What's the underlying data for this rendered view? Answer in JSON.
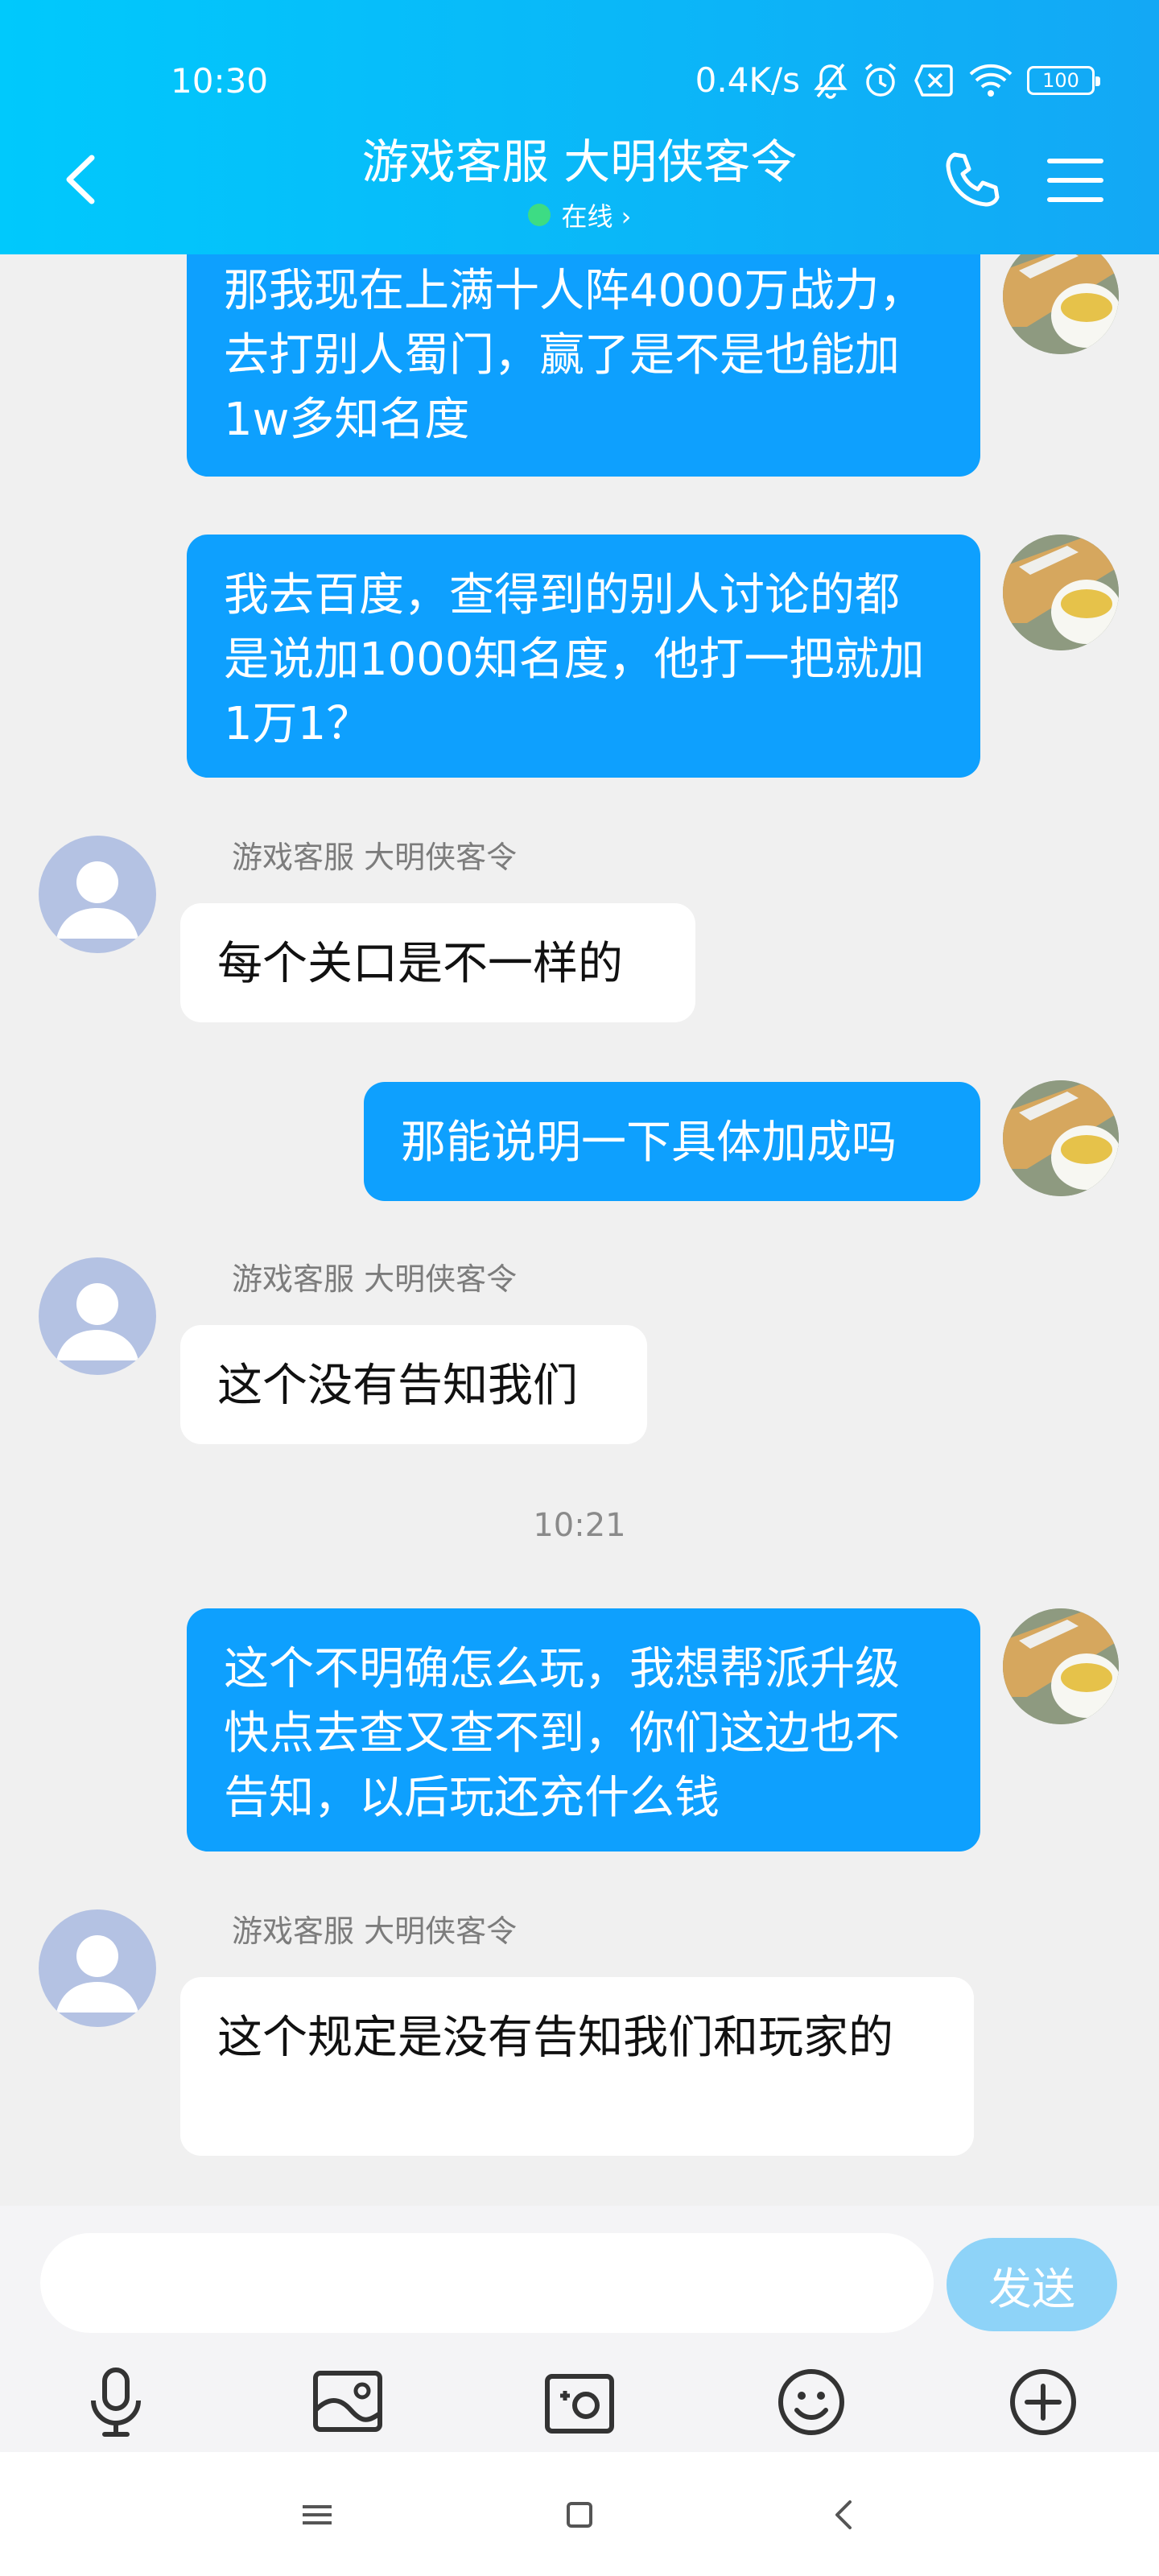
{
  "status_bar": {
    "time": "10:30",
    "net_speed": "0.4K/s",
    "battery": "100"
  },
  "header": {
    "title": "游戏客服 大明侠客令",
    "status": "在线 ›"
  },
  "messages": {
    "m1": "那我现在上满十人阵4000万战力，去打别人蜀门，赢了是不是也能加1w多知名度",
    "m2": "我去百度，查得到的别人讨论的都是说加1000知名度，他打一把就加1万1？",
    "m3_sender": "游戏客服 大明侠客令",
    "m3": "每个关口是不一样的",
    "m4": "那能说明一下具体加成吗",
    "m5_sender": "游戏客服 大明侠客令",
    "m5": "这个没有告知我们",
    "time_divider": "10:21",
    "m6": "这个不明确怎么玩，我想帮派升级快点去查又查不到，你们这边也不告知，以后玩还充什么钱",
    "m7_sender": "游戏客服 大明侠客令",
    "m7": "这个规定是没有告知我们和玩家的"
  },
  "input": {
    "placeholder": "",
    "send_label": "发送"
  },
  "toolbar": [
    "microphone-icon",
    "image-icon",
    "camera-icon",
    "emoji-icon",
    "plus-icon"
  ],
  "colors": {
    "header_start": "#00C9FC",
    "header_end": "#13A8F5",
    "outgoing_bubble": "#0EA0FE",
    "send_button": "#8ED3F8"
  }
}
